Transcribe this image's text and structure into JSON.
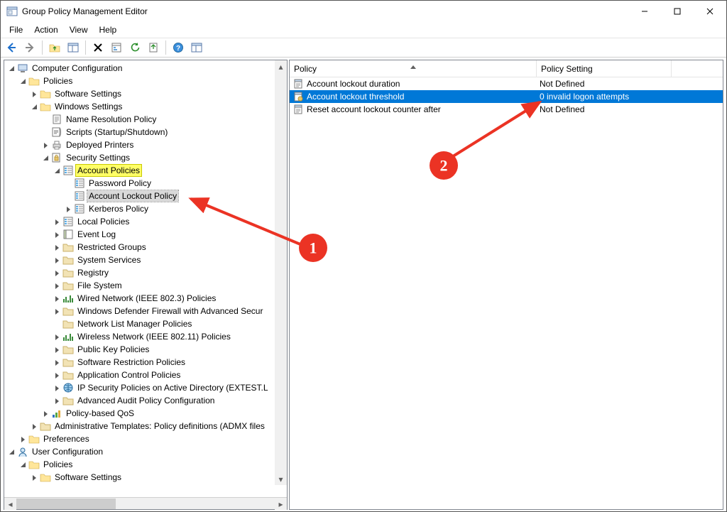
{
  "window": {
    "title": "Group Policy Management Editor"
  },
  "menu": {
    "file": "File",
    "action": "Action",
    "view": "View",
    "help": "Help"
  },
  "tree": {
    "root": "Computer Configuration",
    "policies": "Policies",
    "software_settings": "Software Settings",
    "windows_settings": "Windows Settings",
    "name_resolution": "Name Resolution Policy",
    "scripts": "Scripts (Startup/Shutdown)",
    "deployed_printers": "Deployed Printers",
    "security_settings": "Security Settings",
    "account_policies": "Account Policies",
    "password_policy": "Password Policy",
    "account_lockout_policy": "Account Lockout Policy",
    "kerberos_policy": "Kerberos Policy",
    "local_policies": "Local Policies",
    "event_log": "Event Log",
    "restricted_groups": "Restricted Groups",
    "system_services": "System Services",
    "registry": "Registry",
    "file_system": "File System",
    "wired": "Wired Network (IEEE 802.3) Policies",
    "defender_firewall": "Windows Defender Firewall with Advanced Secur",
    "network_list": "Network List Manager Policies",
    "wireless": "Wireless Network (IEEE 802.11) Policies",
    "public_key": "Public Key Policies",
    "software_restriction": "Software Restriction Policies",
    "application_control": "Application Control Policies",
    "ip_security": "IP Security Policies on Active Directory (EXTEST.L",
    "advanced_audit": "Advanced Audit Policy Configuration",
    "policy_based_qos": "Policy-based QoS",
    "admin_templates": "Administrative Templates: Policy definitions (ADMX files",
    "preferences": "Preferences",
    "user_configuration": "User Configuration",
    "user_policies": "Policies",
    "user_software_settings": "Software Settings"
  },
  "list": {
    "col_policy": "Policy",
    "col_setting": "Policy Setting",
    "rows": [
      {
        "policy": "Account lockout duration",
        "setting": "Not Defined"
      },
      {
        "policy": "Account lockout threshold",
        "setting": "0 invalid logon attempts"
      },
      {
        "policy": "Reset account lockout counter after",
        "setting": "Not Defined"
      }
    ]
  },
  "annotations": {
    "b1": "1",
    "b2": "2"
  }
}
